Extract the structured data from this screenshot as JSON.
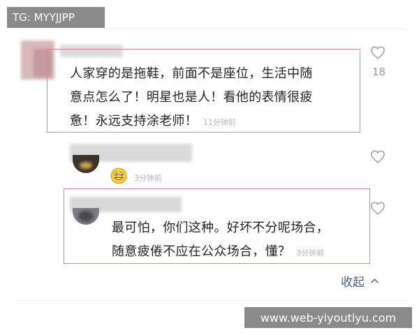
{
  "watermark_top": "TG: MYYJJPP",
  "watermark_bottom": "www.web-yiyoutiyu.com",
  "comments": [
    {
      "text_line1": "人家穿的是拖鞋，前面不是座位，生活中随",
      "text_line2": "意点怎么了！明星也是人！看他的表情很疲",
      "text_line3": "惫！永远支持涂老师！",
      "time": "11分钟前",
      "like_count": "18"
    },
    {
      "time": "3分钟前"
    },
    {
      "text_line1": "最可怕，你们这种。好坏不分呢场合，",
      "text_line2": "随意疲倦不应在公众场合，懂？",
      "time": "3分钟前"
    }
  ],
  "collapse_label": "收起",
  "colors": {
    "highlight_border": "#d9868d",
    "link": "#4a5d84",
    "muted": "#b5b5b5"
  }
}
